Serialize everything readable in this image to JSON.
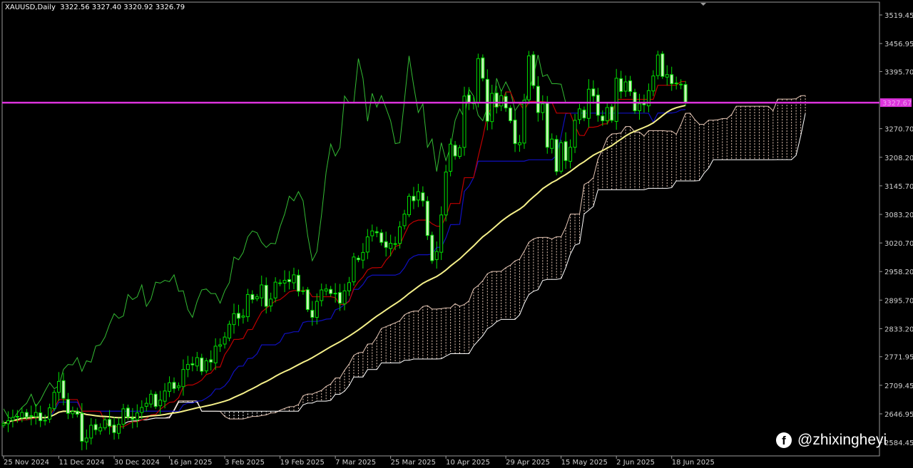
{
  "header": {
    "symbol_title": "XAUUSD,Daily",
    "ohlc": "3322.56 3327.40 3320.92 3326.79"
  },
  "watermark": {
    "handle": "@zhixingheyi",
    "icon": "facebook-icon"
  },
  "colors": {
    "bull": "#00e000",
    "bear": "#c8f0b8",
    "tenkan": "#c00000",
    "kijun": "#1010c0",
    "chikou": "#33bb33",
    "ma": "#f5f08a",
    "cloud_up": "#e6c7b6",
    "cloud_down": "#ffffff",
    "hline": "#dd33dd",
    "axis_text": "#d0d0d0"
  },
  "chart_data": {
    "type": "candlestick",
    "title": "XAUUSD,Daily",
    "ylim": [
      2584.45,
      3540
    ],
    "y_ticks": [
      "3519.45",
      "3456.95",
      "3395.70",
      "3270.70",
      "3208.20",
      "3145.70",
      "3083.20",
      "3020.70",
      "2958.20",
      "2895.70",
      "2833.20",
      "2771.95",
      "2709.45",
      "2646.95",
      "2584.45"
    ],
    "x_ticks": [
      {
        "label": "25 Nov 2024",
        "index": 0
      },
      {
        "label": "11 Dec 2024",
        "index": 12
      },
      {
        "label": "30 Dec 2024",
        "index": 24
      },
      {
        "label": "16 Jan 2025",
        "index": 36
      },
      {
        "label": "3 Feb 2025",
        "index": 48
      },
      {
        "label": "19 Feb 2025",
        "index": 60
      },
      {
        "label": "7 Mar 2025",
        "index": 72
      },
      {
        "label": "25 Mar 2025",
        "index": 84
      },
      {
        "label": "10 Apr 2025",
        "index": 96
      },
      {
        "label": "29 Apr 2025",
        "index": 109
      },
      {
        "label": "15 May 2025",
        "index": 121
      },
      {
        "label": "2 Jun 2025",
        "index": 133
      },
      {
        "label": "18 Jun 2025",
        "index": 145
      }
    ],
    "horizontal_line": {
      "value": 3327.67,
      "label": "3327.67"
    },
    "indicators": [
      "Ichimoku (9,26,52)",
      "Moving Average"
    ],
    "closes": [
      2626,
      2632,
      2639,
      2640,
      2650,
      2640,
      2643,
      2650,
      2632,
      2633,
      2660,
      2694,
      2718,
      2681,
      2648,
      2652,
      2646,
      2587,
      2594,
      2622,
      2612,
      2617,
      2634,
      2620,
      2606,
      2624,
      2658,
      2640,
      2635,
      2649,
      2661,
      2670,
      2690,
      2663,
      2677,
      2697,
      2715,
      2702,
      2708,
      2744,
      2755,
      2754,
      2770,
      2740,
      2763,
      2760,
      2795,
      2798,
      2815,
      2843,
      2866,
      2856,
      2861,
      2908,
      2897,
      2903,
      2929,
      2882,
      2898,
      2935,
      2933,
      2939,
      2936,
      2951,
      2915,
      2916,
      2875,
      2858,
      2893,
      2918,
      2920,
      2910,
      2910,
      2889,
      2916,
      2934,
      2990,
      2984,
      3000,
      3034,
      3047,
      3043,
      3022,
      3011,
      3020,
      3019,
      3056,
      3084,
      3123,
      3113,
      3133,
      3113,
      3037,
      2982,
      3002,
      3082,
      3176,
      3237,
      3211,
      3229,
      3342,
      3327,
      3327,
      3424,
      3381,
      3287,
      3348,
      3318,
      3343,
      3316,
      3288,
      3238,
      3240,
      3333,
      3430,
      3365,
      3306,
      3325,
      3230,
      3248,
      3177,
      3240,
      3201,
      3230,
      3289,
      3314,
      3294,
      3357,
      3342,
      3300,
      3288,
      3317,
      3289,
      3381,
      3352,
      3373,
      3352,
      3310,
      3325,
      3323,
      3354,
      3386,
      3432,
      3385,
      3389,
      3369,
      3369,
      3368,
      3327
    ]
  }
}
